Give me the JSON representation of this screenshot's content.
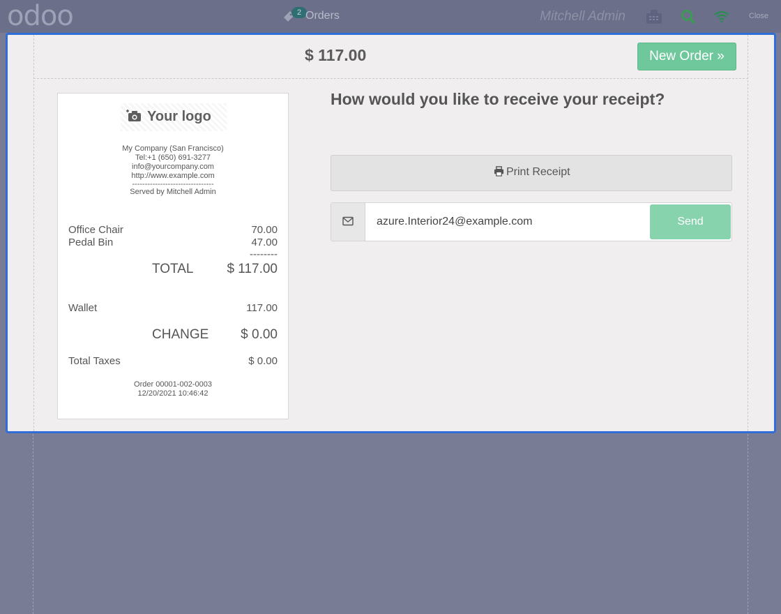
{
  "topbar": {
    "logo": "odoo",
    "orders_badge": "2",
    "orders_label": "Orders",
    "user_name": "Mitchell Admin",
    "close_label": "Close",
    "icons": [
      "ticket-icon",
      "cash-register-icon",
      "search-icon",
      "wifi-icon"
    ],
    "colors": {
      "bar": "#6b6f8a",
      "badge": "#2f6e73",
      "search": "#3c9a55",
      "wifi": "#2e8b57"
    }
  },
  "header": {
    "amount": "$ 117.00",
    "new_order_label": "New Order »"
  },
  "receipt": {
    "logo_text": "Your logo",
    "company": {
      "name": "My Company (San Francisco)",
      "phone": "Tel:+1 (650) 691-3277",
      "email": "info@yourcompany.com",
      "website": "http://www.example.com",
      "separator": "--------------------------------",
      "served_by": "Served by Mitchell Admin"
    },
    "lines": [
      {
        "product": "Office Chair",
        "price": "70.00"
      },
      {
        "product": "Pedal Bin",
        "price": "47.00"
      }
    ],
    "separator": "--------",
    "total_label": "TOTAL",
    "total_value": "$ 117.00",
    "payment": {
      "method": "Wallet",
      "amount": "117.00"
    },
    "change_label": "CHANGE",
    "change_value": "$ 0.00",
    "taxes_label": "Total Taxes",
    "taxes_value": "$ 0.00",
    "order_ref": "Order 00001-002-0003",
    "order_date": "12/20/2021 10:46:42"
  },
  "receipt_options": {
    "question": "How would you like to receive your receipt?",
    "print_label": "Print Receipt",
    "email_value": "azure.Interior24@example.com",
    "send_label": "Send"
  },
  "colors": {
    "modal_border": "#2f6dd8",
    "primary_button": "#6ec89b",
    "send_button": "#86d3ad"
  }
}
